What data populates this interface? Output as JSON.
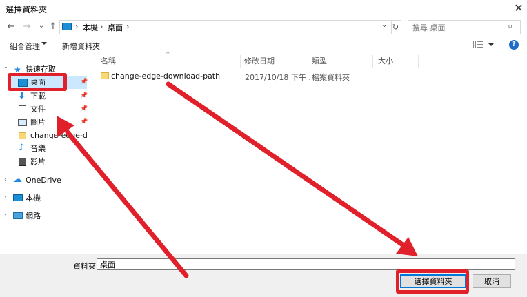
{
  "window": {
    "title": "選擇資料夾",
    "close_glyph": "✕"
  },
  "nav": {
    "back": "←",
    "forward": "→",
    "dropdown": "⌄",
    "up": "↑",
    "breadcrumb": [
      "本機",
      "桌面"
    ],
    "sep": "›",
    "refresh": "↻",
    "search_placeholder": "搜尋 桌面",
    "search_glyph": "⌕"
  },
  "toolbar": {
    "organize": "組合管理",
    "new_folder": "新增資料夾",
    "help": "?"
  },
  "sidebar": {
    "quick_access": "快速存取",
    "items": [
      {
        "label": "桌面",
        "icon": "desktop-icon",
        "pinned": true
      },
      {
        "label": "下載",
        "icon": "download-icon",
        "pinned": true
      },
      {
        "label": "文件",
        "icon": "document-icon",
        "pinned": true
      },
      {
        "label": "圖片",
        "icon": "pictures-icon",
        "pinned": true
      },
      {
        "label": "change-edge-dov",
        "icon": "folder-icon",
        "pinned": false
      },
      {
        "label": "音樂",
        "icon": "music-icon",
        "pinned": false
      },
      {
        "label": "影片",
        "icon": "video-icon",
        "pinned": false
      }
    ],
    "onedrive": "OneDrive",
    "this_pc": "本機",
    "network": "網路",
    "pin_glyph": "📌"
  },
  "columns": {
    "name": "名稱",
    "modified": "修改日期",
    "type": "類型",
    "size": "大小"
  },
  "files": [
    {
      "name": "change-edge-download-path",
      "modified": "2017/10/18 下午 ...",
      "type": "檔案資料夾",
      "size": ""
    }
  ],
  "footer": {
    "folder_label": "資料夾:",
    "folder_value": "桌面",
    "select_button": "選擇資料夾",
    "cancel_button": "取消"
  },
  "colors": {
    "annotation_red": "#e0202a",
    "accent": "#0078d7",
    "help_blue": "#1e6cc4"
  }
}
